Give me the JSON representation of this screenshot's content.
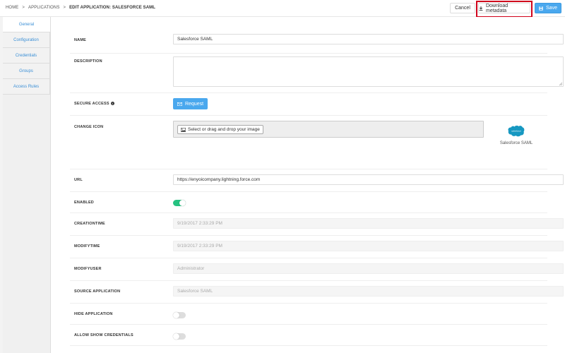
{
  "breadcrumb": {
    "items": [
      "HOME",
      "APPLICATIONS",
      "EDIT APPLICATION: SALESFORCE SAML"
    ],
    "separator": ">"
  },
  "toolbar": {
    "cancel_label": "Cancel",
    "download_label": "Download metadata",
    "save_label": "Save"
  },
  "sidebar": {
    "items": [
      {
        "label": "General",
        "active": true
      },
      {
        "label": "Configuration",
        "active": false
      },
      {
        "label": "Credentials",
        "active": false
      },
      {
        "label": "Groups",
        "active": false
      },
      {
        "label": "Access Rules",
        "active": false
      }
    ]
  },
  "form": {
    "name": {
      "label": "NAME",
      "value": "Salesforce SAML"
    },
    "description": {
      "label": "DESCRIPTION",
      "value": ""
    },
    "secure_access": {
      "label": "SECURE ACCESS",
      "button": "Request"
    },
    "change_icon": {
      "label": "CHANGE ICON",
      "button": "Select or drag and drop your image",
      "preview_name": "Salesforce SAML",
      "logo_text": "salesforce"
    },
    "url": {
      "label": "URL",
      "value": "https://enyoicompany.lightning.force.com"
    },
    "enabled": {
      "label": "ENABLED",
      "on": true
    },
    "creationtime": {
      "label": "CREATIONTIME",
      "value": "9/19/2017 2:33:29 PM"
    },
    "modifytime": {
      "label": "MODIFYTIME",
      "value": "9/19/2017 2:33:29 PM"
    },
    "modifyuser": {
      "label": "MODIFYUSER",
      "value": "Administrator"
    },
    "source_application": {
      "label": "SOURCE APPLICATION",
      "value": "Salesforce SAML"
    },
    "hide_application": {
      "label": "HIDE APPLICATION",
      "on": false
    },
    "allow_show_credentials": {
      "label": "ALLOW SHOW CREDENTIALS",
      "on": false
    }
  },
  "colors": {
    "accent": "#4aa8ee",
    "toggle_on": "#26c281",
    "highlight": "#d0021b",
    "salesforce": "#1798c1"
  },
  "icons": {
    "download": "download-icon",
    "save": "floppy-disk-icon",
    "request": "envelope-icon",
    "image": "image-icon",
    "info": "info-icon"
  }
}
